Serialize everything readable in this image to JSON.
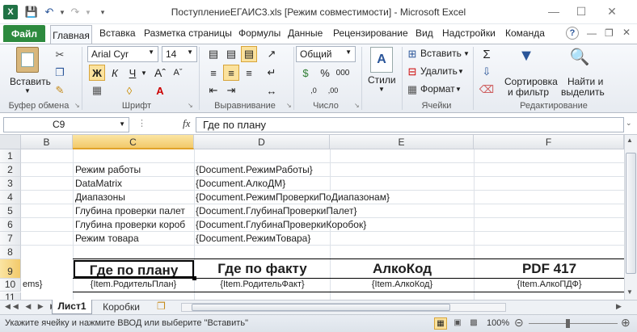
{
  "window": {
    "title": "ПоступлениеЕГАИС3.xls  [Режим совместимости]  -  Microsoft Excel"
  },
  "tabs": {
    "file": "Файл",
    "items": [
      "Главная",
      "Вставка",
      "Разметка страницы",
      "Формулы",
      "Данные",
      "Рецензирование",
      "Вид",
      "Надстройки",
      "Команда"
    ]
  },
  "ribbon": {
    "clipboard": {
      "paste": "Вставить",
      "label": "Буфер обмена"
    },
    "font": {
      "name": "Arial Cyr",
      "size": "14",
      "bold": "Ж",
      "italic": "К",
      "underline": "Ч",
      "label": "Шрифт"
    },
    "alignment": {
      "label": "Выравнивание"
    },
    "number": {
      "format": "Общий",
      "label": "Число"
    },
    "styles": {
      "label": "Стили"
    },
    "cells": {
      "insert": "Вставить",
      "delete": "Удалить",
      "format": "Формат",
      "label": "Ячейки"
    },
    "editing": {
      "sort1": "Сортировка",
      "sort2": "и фильтр",
      "find1": "Найти и",
      "find2": "выделить",
      "label": "Редактирование"
    }
  },
  "formula_bar": {
    "cell_ref": "C9",
    "fx": "fx",
    "value": "Где по плану"
  },
  "grid": {
    "columns": [
      "B",
      "C",
      "D",
      "E",
      "F"
    ],
    "selected_column": "C",
    "selected_row": "9",
    "rows": [
      {
        "num": "1",
        "b": "",
        "c": "",
        "d": "",
        "e": "",
        "f": ""
      },
      {
        "num": "2",
        "b": "",
        "c": "Режим работы",
        "d": "{Document.РежимРаботы}",
        "e": "",
        "f": ""
      },
      {
        "num": "3",
        "b": "",
        "c": "DataMatrix",
        "d": "{Document.АлкоДМ}",
        "e": "",
        "f": ""
      },
      {
        "num": "4",
        "b": "",
        "c": "Диапазоны",
        "d": "{Document.РежимПроверкиПоДиапазонам}",
        "e": "",
        "f": ""
      },
      {
        "num": "5",
        "b": "",
        "c": "Глубина проверки палет",
        "d": "{Document.ГлубинаПроверкиПалет}",
        "e": "",
        "f": ""
      },
      {
        "num": "6",
        "b": "",
        "c": "Глубина проверки короб",
        "d": "{Document.ГлубинаПроверкиКоробок}",
        "e": "",
        "f": ""
      },
      {
        "num": "7",
        "b": "",
        "c": "Режим товара",
        "d": "{Document.РежимТовара}",
        "e": "",
        "f": ""
      },
      {
        "num": "8",
        "b": "",
        "c": "",
        "d": "",
        "e": "",
        "f": ""
      },
      {
        "num": "9",
        "b": "",
        "c": "Где по плану",
        "d": "Где по факту",
        "e": "АлкоКод",
        "f": "PDF 417"
      },
      {
        "num": "10",
        "b": "ems}",
        "c": "{Item.РодительПлан}",
        "d": "{Item.РодительФакт}",
        "e": "{Item.АлкоКод}",
        "f": "{Item.АлкоПДФ}"
      },
      {
        "num": "11",
        "b": "",
        "c": "",
        "d": "",
        "e": "",
        "f": ""
      }
    ]
  },
  "sheets": {
    "items": [
      "Лист1",
      "Коробки"
    ],
    "active": "Лист1"
  },
  "status": {
    "text": "Укажите ячейку и нажмите ВВОД или выберите \"Вставить\"",
    "zoom": "100%"
  }
}
